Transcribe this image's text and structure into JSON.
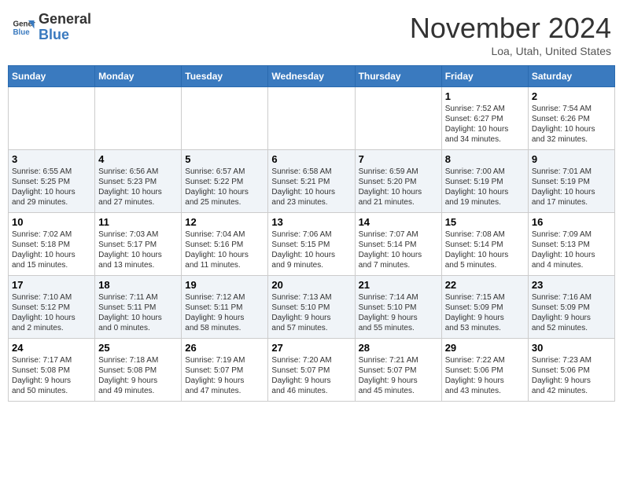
{
  "header": {
    "logo_line1": "General",
    "logo_line2": "Blue",
    "month": "November 2024",
    "location": "Loa, Utah, United States"
  },
  "weekdays": [
    "Sunday",
    "Monday",
    "Tuesday",
    "Wednesday",
    "Thursday",
    "Friday",
    "Saturday"
  ],
  "weeks": [
    [
      {
        "day": "",
        "info": ""
      },
      {
        "day": "",
        "info": ""
      },
      {
        "day": "",
        "info": ""
      },
      {
        "day": "",
        "info": ""
      },
      {
        "day": "",
        "info": ""
      },
      {
        "day": "1",
        "info": "Sunrise: 7:52 AM\nSunset: 6:27 PM\nDaylight: 10 hours\nand 34 minutes."
      },
      {
        "day": "2",
        "info": "Sunrise: 7:54 AM\nSunset: 6:26 PM\nDaylight: 10 hours\nand 32 minutes."
      }
    ],
    [
      {
        "day": "3",
        "info": "Sunrise: 6:55 AM\nSunset: 5:25 PM\nDaylight: 10 hours\nand 29 minutes."
      },
      {
        "day": "4",
        "info": "Sunrise: 6:56 AM\nSunset: 5:23 PM\nDaylight: 10 hours\nand 27 minutes."
      },
      {
        "day": "5",
        "info": "Sunrise: 6:57 AM\nSunset: 5:22 PM\nDaylight: 10 hours\nand 25 minutes."
      },
      {
        "day": "6",
        "info": "Sunrise: 6:58 AM\nSunset: 5:21 PM\nDaylight: 10 hours\nand 23 minutes."
      },
      {
        "day": "7",
        "info": "Sunrise: 6:59 AM\nSunset: 5:20 PM\nDaylight: 10 hours\nand 21 minutes."
      },
      {
        "day": "8",
        "info": "Sunrise: 7:00 AM\nSunset: 5:19 PM\nDaylight: 10 hours\nand 19 minutes."
      },
      {
        "day": "9",
        "info": "Sunrise: 7:01 AM\nSunset: 5:19 PM\nDaylight: 10 hours\nand 17 minutes."
      }
    ],
    [
      {
        "day": "10",
        "info": "Sunrise: 7:02 AM\nSunset: 5:18 PM\nDaylight: 10 hours\nand 15 minutes."
      },
      {
        "day": "11",
        "info": "Sunrise: 7:03 AM\nSunset: 5:17 PM\nDaylight: 10 hours\nand 13 minutes."
      },
      {
        "day": "12",
        "info": "Sunrise: 7:04 AM\nSunset: 5:16 PM\nDaylight: 10 hours\nand 11 minutes."
      },
      {
        "day": "13",
        "info": "Sunrise: 7:06 AM\nSunset: 5:15 PM\nDaylight: 10 hours\nand 9 minutes."
      },
      {
        "day": "14",
        "info": "Sunrise: 7:07 AM\nSunset: 5:14 PM\nDaylight: 10 hours\nand 7 minutes."
      },
      {
        "day": "15",
        "info": "Sunrise: 7:08 AM\nSunset: 5:14 PM\nDaylight: 10 hours\nand 5 minutes."
      },
      {
        "day": "16",
        "info": "Sunrise: 7:09 AM\nSunset: 5:13 PM\nDaylight: 10 hours\nand 4 minutes."
      }
    ],
    [
      {
        "day": "17",
        "info": "Sunrise: 7:10 AM\nSunset: 5:12 PM\nDaylight: 10 hours\nand 2 minutes."
      },
      {
        "day": "18",
        "info": "Sunrise: 7:11 AM\nSunset: 5:11 PM\nDaylight: 10 hours\nand 0 minutes."
      },
      {
        "day": "19",
        "info": "Sunrise: 7:12 AM\nSunset: 5:11 PM\nDaylight: 9 hours\nand 58 minutes."
      },
      {
        "day": "20",
        "info": "Sunrise: 7:13 AM\nSunset: 5:10 PM\nDaylight: 9 hours\nand 57 minutes."
      },
      {
        "day": "21",
        "info": "Sunrise: 7:14 AM\nSunset: 5:10 PM\nDaylight: 9 hours\nand 55 minutes."
      },
      {
        "day": "22",
        "info": "Sunrise: 7:15 AM\nSunset: 5:09 PM\nDaylight: 9 hours\nand 53 minutes."
      },
      {
        "day": "23",
        "info": "Sunrise: 7:16 AM\nSunset: 5:09 PM\nDaylight: 9 hours\nand 52 minutes."
      }
    ],
    [
      {
        "day": "24",
        "info": "Sunrise: 7:17 AM\nSunset: 5:08 PM\nDaylight: 9 hours\nand 50 minutes."
      },
      {
        "day": "25",
        "info": "Sunrise: 7:18 AM\nSunset: 5:08 PM\nDaylight: 9 hours\nand 49 minutes."
      },
      {
        "day": "26",
        "info": "Sunrise: 7:19 AM\nSunset: 5:07 PM\nDaylight: 9 hours\nand 47 minutes."
      },
      {
        "day": "27",
        "info": "Sunrise: 7:20 AM\nSunset: 5:07 PM\nDaylight: 9 hours\nand 46 minutes."
      },
      {
        "day": "28",
        "info": "Sunrise: 7:21 AM\nSunset: 5:07 PM\nDaylight: 9 hours\nand 45 minutes."
      },
      {
        "day": "29",
        "info": "Sunrise: 7:22 AM\nSunset: 5:06 PM\nDaylight: 9 hours\nand 43 minutes."
      },
      {
        "day": "30",
        "info": "Sunrise: 7:23 AM\nSunset: 5:06 PM\nDaylight: 9 hours\nand 42 minutes."
      }
    ]
  ]
}
